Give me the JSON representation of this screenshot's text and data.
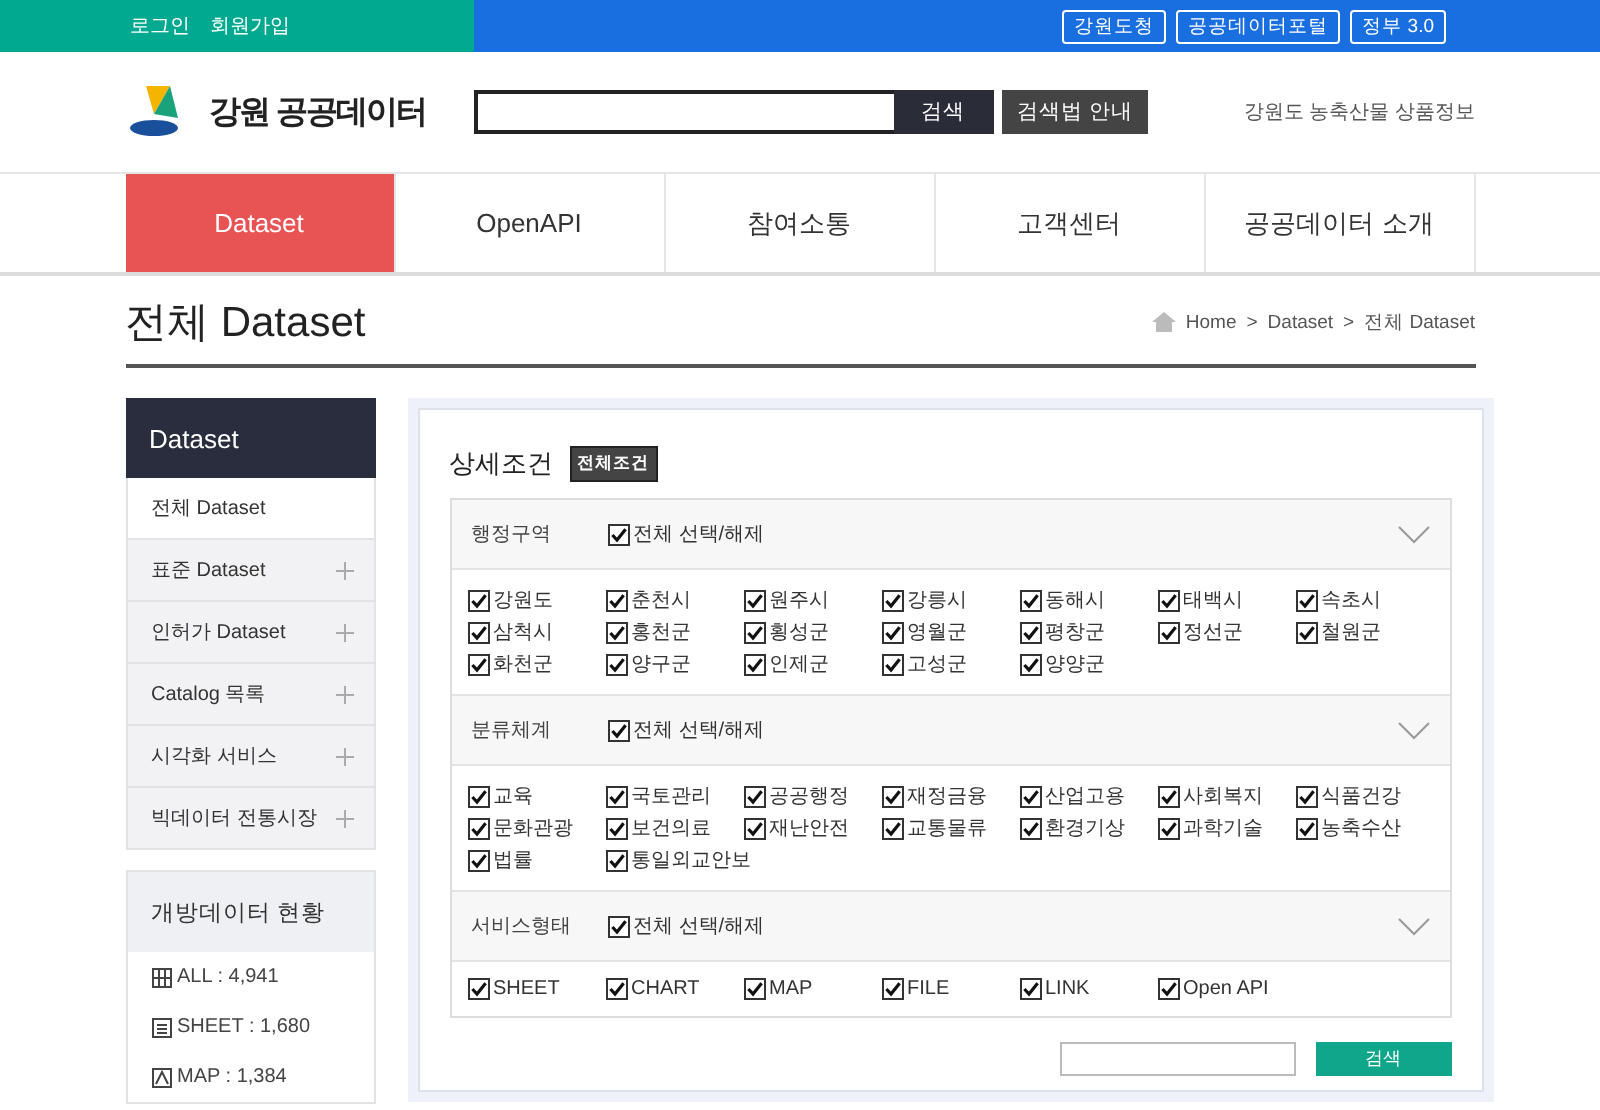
{
  "top_bar": {
    "left_links": [
      "로그인",
      "회원가입"
    ],
    "right_links": [
      "강원도청",
      "공공데이터포털",
      "정부 3.0"
    ]
  },
  "header": {
    "logo_text": "강원 공공데이터",
    "search": {
      "button": "검색"
    },
    "guide_button": "검색법 안내",
    "side_link": "강원도 농축산물 상품정보"
  },
  "nav": [
    {
      "label": "Dataset",
      "selected": true
    },
    {
      "label": "OpenAPI",
      "selected": false
    },
    {
      "label": "참여소통",
      "selected": false
    },
    {
      "label": "고객센터",
      "selected": false
    },
    {
      "label": "공공데이터 소개",
      "selected": false
    }
  ],
  "page_title": "전체 Dataset",
  "breadcrumb": [
    "Home",
    "Dataset",
    "전체 Dataset"
  ],
  "breadcrumb_separator": ">",
  "sidebar": {
    "title": "Dataset",
    "items": [
      {
        "label": "전체 Dataset",
        "selected": true,
        "expandable": false
      },
      {
        "label": "표준 Dataset",
        "selected": false,
        "expandable": true
      },
      {
        "label": "인허가 Dataset",
        "selected": false,
        "expandable": true
      },
      {
        "label": "Catalog 목록",
        "selected": false,
        "expandable": true
      },
      {
        "label": "시각화 서비스",
        "selected": false,
        "expandable": true
      },
      {
        "label": "빅데이터 전통시장",
        "selected": false,
        "expandable": true
      }
    ]
  },
  "stats": {
    "title": "개방데이터 현황",
    "items": [
      {
        "kind": "all",
        "label": "ALL : 4,941"
      },
      {
        "kind": "sheet",
        "label": "SHEET : 1,680"
      },
      {
        "kind": "map",
        "label": "MAP : 1,384"
      }
    ]
  },
  "filter": {
    "title": "상세조건",
    "badge": "전체조건",
    "sections": [
      {
        "name": "행정구역",
        "select_all": {
          "label": "전체 선택/해제",
          "checked": true
        },
        "options": [
          {
            "label": "강원도",
            "checked": true
          },
          {
            "label": "춘천시",
            "checked": true
          },
          {
            "label": "원주시",
            "checked": true
          },
          {
            "label": "강릉시",
            "checked": true
          },
          {
            "label": "동해시",
            "checked": true
          },
          {
            "label": "태백시",
            "checked": true
          },
          {
            "label": "속초시",
            "checked": true
          },
          {
            "label": "삼척시",
            "checked": true
          },
          {
            "label": "홍천군",
            "checked": true
          },
          {
            "label": "횡성군",
            "checked": true
          },
          {
            "label": "영월군",
            "checked": true
          },
          {
            "label": "평창군",
            "checked": true
          },
          {
            "label": "정선군",
            "checked": true
          },
          {
            "label": "철원군",
            "checked": true
          },
          {
            "label": "화천군",
            "checked": true
          },
          {
            "label": "양구군",
            "checked": true
          },
          {
            "label": "인제군",
            "checked": true
          },
          {
            "label": "고성군",
            "checked": true
          },
          {
            "label": "양양군",
            "checked": true
          }
        ]
      },
      {
        "name": "분류체계",
        "select_all": {
          "label": "전체 선택/해제",
          "checked": true
        },
        "options": [
          {
            "label": "교육",
            "checked": true
          },
          {
            "label": "국토관리",
            "checked": true
          },
          {
            "label": "공공행정",
            "checked": true
          },
          {
            "label": "재정금융",
            "checked": true
          },
          {
            "label": "산업고용",
            "checked": true
          },
          {
            "label": "사회복지",
            "checked": true
          },
          {
            "label": "식품건강",
            "checked": true
          },
          {
            "label": "문화관광",
            "checked": true
          },
          {
            "label": "보건의료",
            "checked": true
          },
          {
            "label": "재난안전",
            "checked": true
          },
          {
            "label": "교통물류",
            "checked": true
          },
          {
            "label": "환경기상",
            "checked": true
          },
          {
            "label": "과학기술",
            "checked": true
          },
          {
            "label": "농축수산",
            "checked": true
          },
          {
            "label": "법률",
            "checked": true
          },
          {
            "label": "통일외교안보",
            "checked": true
          }
        ]
      },
      {
        "name": "서비스형태",
        "select_all": {
          "label": "전체 선택/해제",
          "checked": true
        },
        "options": [
          {
            "label": "SHEET",
            "checked": true
          },
          {
            "label": "CHART",
            "checked": true
          },
          {
            "label": "MAP",
            "checked": true
          },
          {
            "label": "FILE",
            "checked": true
          },
          {
            "label": "LINK",
            "checked": true
          },
          {
            "label": "Open API",
            "checked": true
          }
        ]
      }
    ],
    "search_button": "검색"
  }
}
